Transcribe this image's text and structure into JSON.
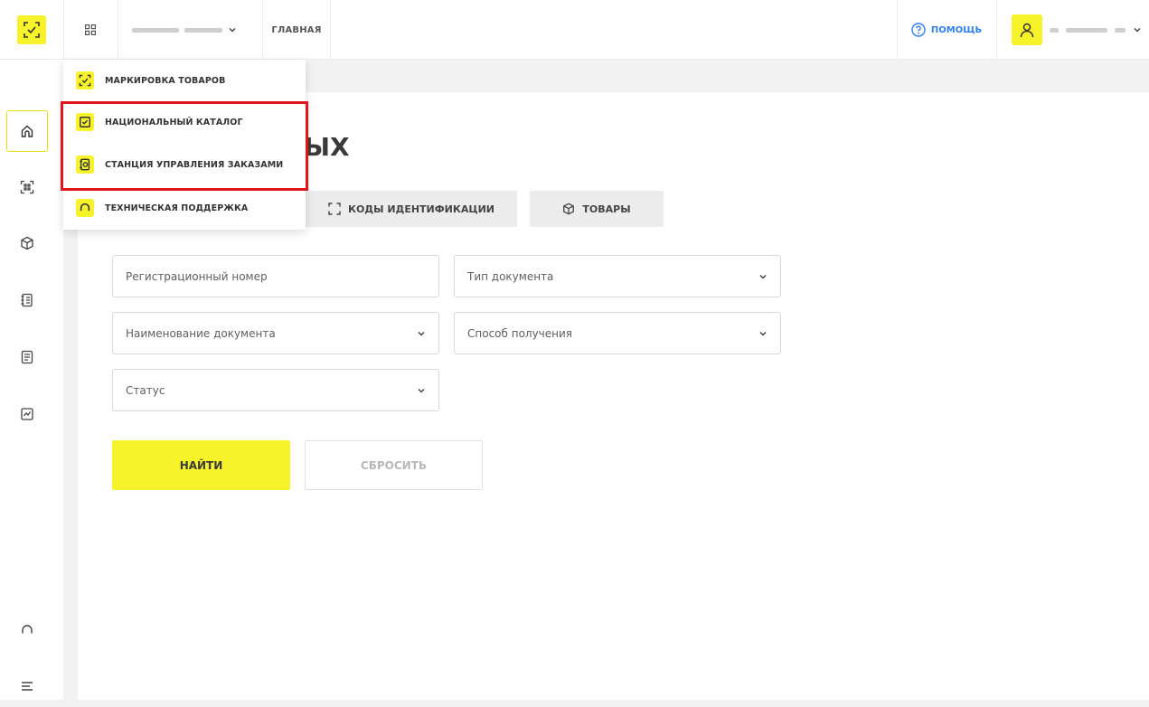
{
  "header": {
    "org_name": "",
    "home_link": "ГЛАВНАЯ",
    "help_label": "ПОМОЩЬ",
    "user_name": ""
  },
  "page": {
    "title": "ЫХ"
  },
  "tabs": [
    {
      "label": "КОДЫ ИДЕНТИФИКАЦИИ",
      "icon": "scan-frame-icon"
    },
    {
      "label": "ТОВАРЫ",
      "icon": "box-icon"
    }
  ],
  "filters": {
    "reg_number": {
      "placeholder": "Регистрационный номер"
    },
    "doc_type": {
      "placeholder": "Тип документа"
    },
    "doc_name": {
      "placeholder": "Наименование документа"
    },
    "receive_method": {
      "placeholder": "Способ получения"
    },
    "status": {
      "placeholder": "Статус"
    }
  },
  "buttons": {
    "find": "НАЙТИ",
    "reset": "СБРОСИТЬ"
  },
  "app_menu": {
    "items": [
      {
        "label": "МАРКИРОВКА ТОВАРОВ",
        "icon": "marking-icon"
      },
      {
        "label": "НАЦИОНАЛЬНЫЙ КАТАЛОГ",
        "icon": "catalog-check-icon"
      },
      {
        "label": "СТАНЦИЯ УПРАВЛЕНИЯ ЗАКАЗАМИ",
        "icon": "order-station-icon"
      },
      {
        "label": "ТЕХНИЧЕСКАЯ ПОДДЕРЖКА",
        "icon": "headset-icon"
      }
    ]
  },
  "sidebar": {
    "items": [
      {
        "icon": "home-icon"
      },
      {
        "icon": "scan-code-icon"
      },
      {
        "icon": "box-icon"
      },
      {
        "icon": "list-doc-icon"
      },
      {
        "icon": "document-icon"
      },
      {
        "icon": "chart-box-icon"
      },
      {
        "icon": "headset-icon"
      },
      {
        "icon": "menu-icon"
      }
    ]
  },
  "colors": {
    "accent": "#f6f32b",
    "highlight": "#e2151c",
    "link": "#2f80ed"
  }
}
